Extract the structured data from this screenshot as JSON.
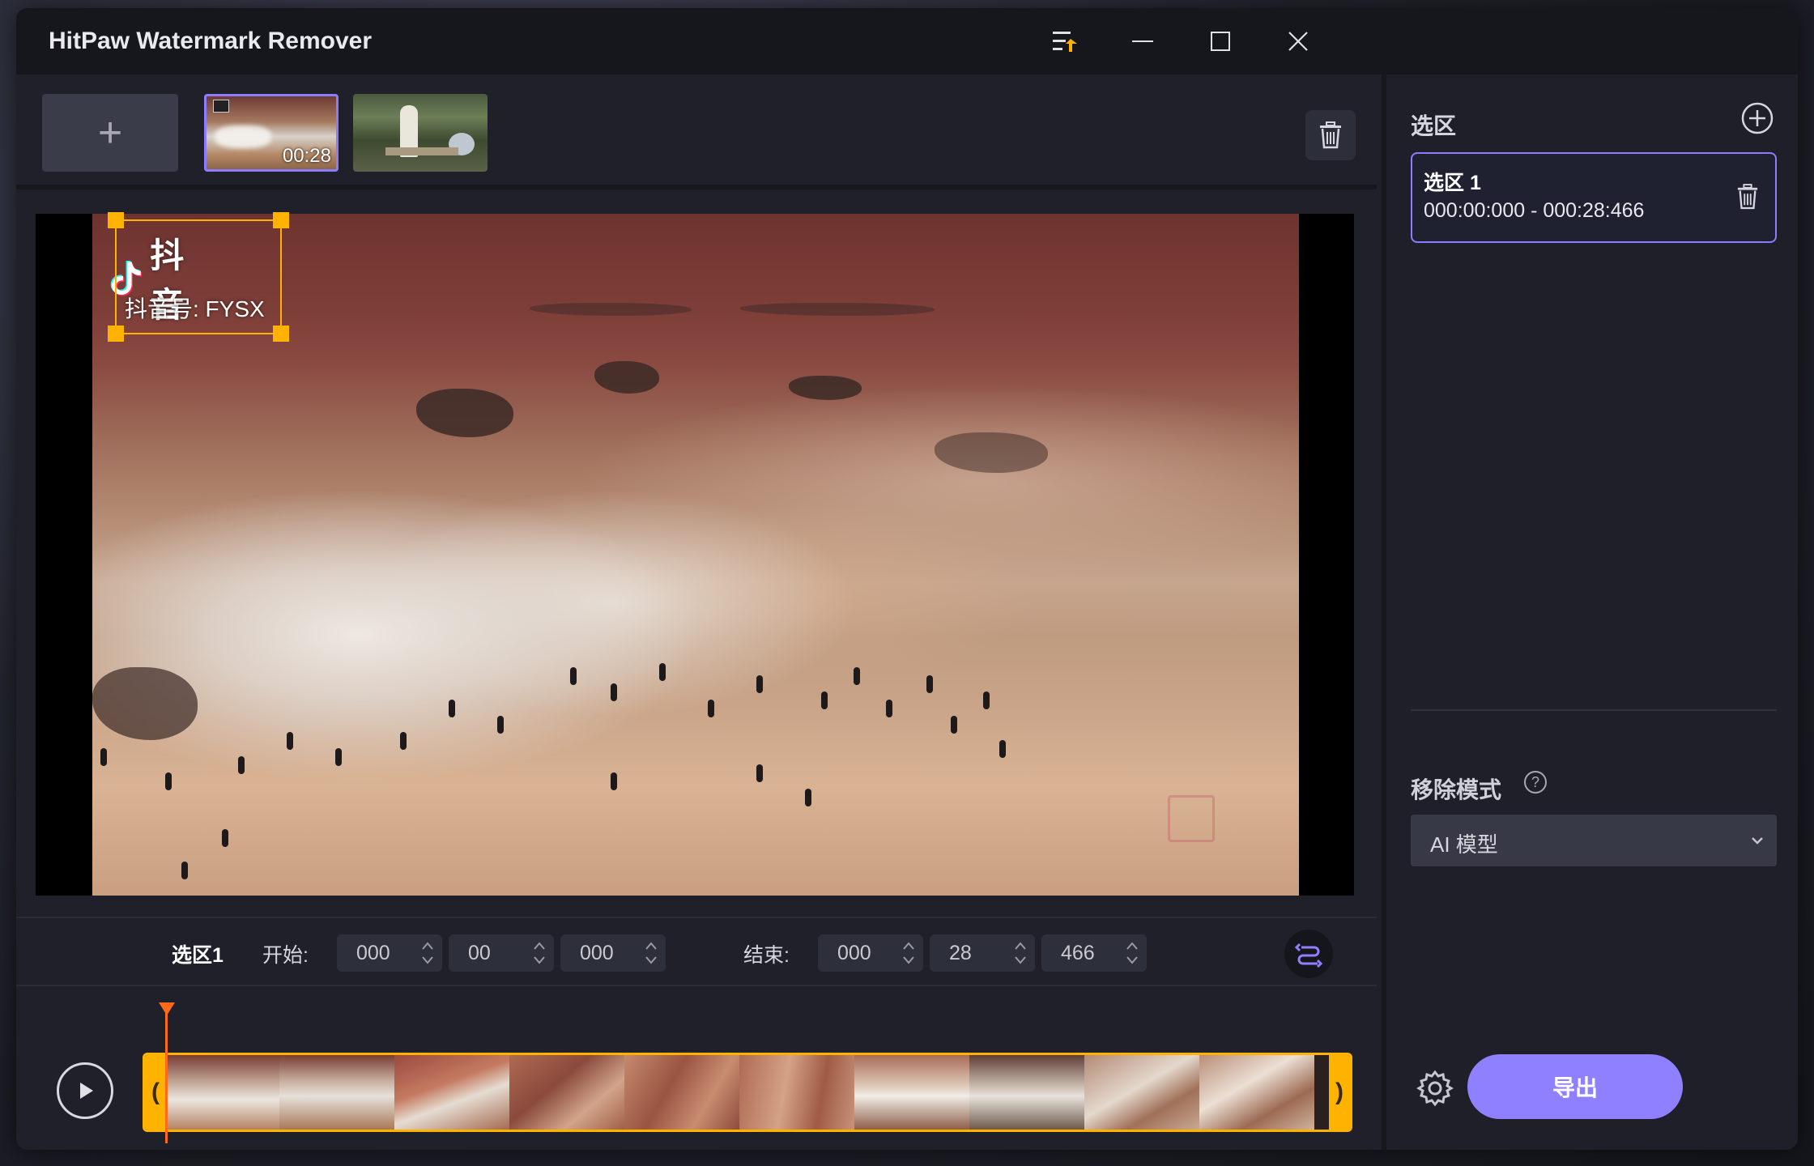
{
  "window": {
    "title": "HitPaw Watermark Remover"
  },
  "titlebar_buttons": [
    {
      "name": "menu-icon"
    },
    {
      "name": "minimize-icon"
    },
    {
      "name": "maximize-icon"
    },
    {
      "name": "close-icon"
    }
  ],
  "media": {
    "add_label": "+",
    "thumbnails": [
      {
        "duration": "00:28",
        "selected": true
      },
      {
        "duration": "",
        "selected": false
      }
    ]
  },
  "watermark": {
    "logo_text": "抖音",
    "id_text": "抖音号: FYSX"
  },
  "range": {
    "name": "选区1",
    "start_label": "开始:",
    "end_label": "结束:",
    "start": {
      "min": "000",
      "sec": "00",
      "ms": "000"
    },
    "end": {
      "min": "000",
      "sec": "28",
      "ms": "466"
    }
  },
  "timeline": {
    "left_handle": "(",
    "right_handle": ")",
    "playhead_position_fraction": 0.0
  },
  "right_panel": {
    "section_title": "选区",
    "selections": [
      {
        "name": "选区 1",
        "time": "000:00:000 - 000:28:466"
      }
    ],
    "mode_label": "移除模式",
    "mode_help": "?",
    "mode_value": "AI 模型",
    "export_label": "导出"
  },
  "colors": {
    "accent": "#8f80ff",
    "selection_box": "#ffb300",
    "playhead": "#ff6a1a",
    "window_bg": "#1f2029"
  }
}
